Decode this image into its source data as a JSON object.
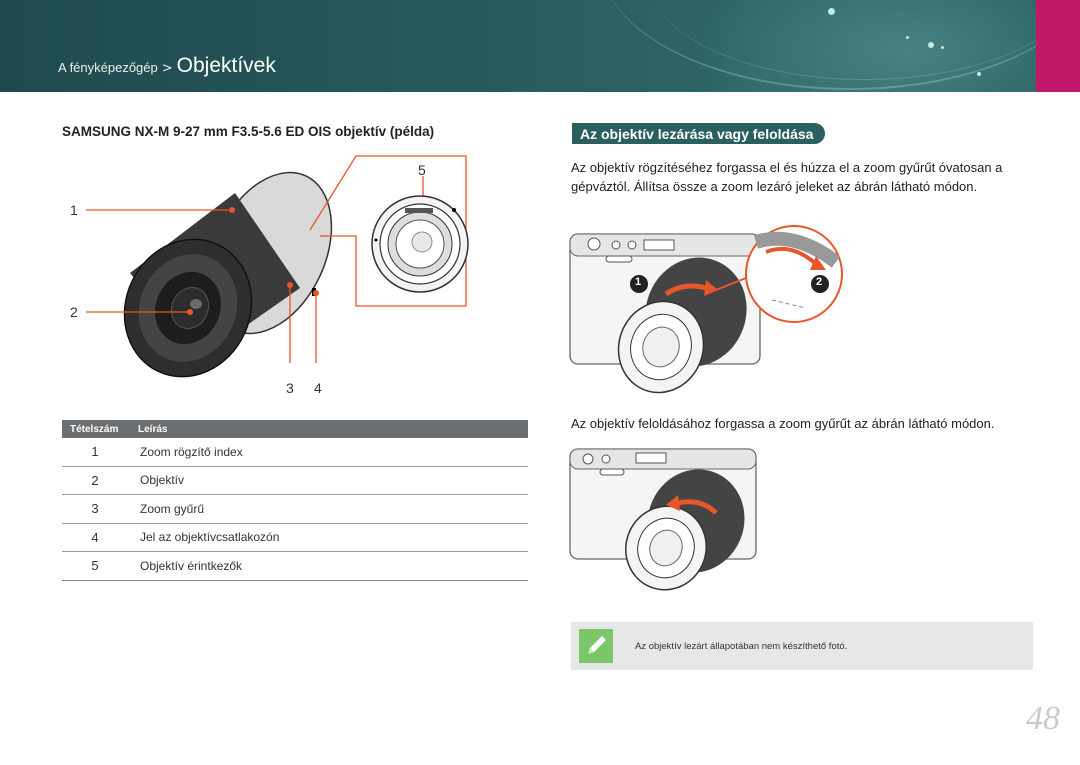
{
  "header": {
    "breadcrumb_parent": "A fényképezőgép",
    "breadcrumb_separator": ">",
    "breadcrumb_current": "Objektívek"
  },
  "left": {
    "subtitle": "SAMSUNG NX-M 9-27 mm F3.5-5.6 ED OIS objektív (példa)",
    "callouts": [
      "1",
      "2",
      "3",
      "4",
      "5"
    ],
    "table": {
      "headers": [
        "Tételszám",
        "Leírás"
      ],
      "rows": [
        {
          "num": "1",
          "desc": "Zoom rögzítő index"
        },
        {
          "num": "2",
          "desc": "Objektív"
        },
        {
          "num": "3",
          "desc": "Zoom gyűrű"
        },
        {
          "num": "4",
          "desc": "Jel az objektívcsatlakozón"
        },
        {
          "num": "5",
          "desc": "Objektív érintkezők"
        }
      ]
    }
  },
  "right": {
    "section_title": "Az objektív lezárása vagy feloldása",
    "lock_text": "Az objektív rögzítéséhez forgassa el és húzza el a zoom gyűrűt óvatosan a gépváztól. Állítsa össze a zoom lezáró jeleket az ábrán látható módon.",
    "unlock_text": "Az objektív feloldásához forgassa a zoom gyűrűt az ábrán látható módon.",
    "step_markers": [
      "1",
      "2"
    ],
    "note_text": "Az objektív lezárt állapotában nem készíthető fotó."
  },
  "colors": {
    "header_teal": "#27585b",
    "accent_pink": "#c2186b",
    "callout_orange": "#e8562a",
    "note_green": "#7bc56b"
  },
  "page_number": "48"
}
